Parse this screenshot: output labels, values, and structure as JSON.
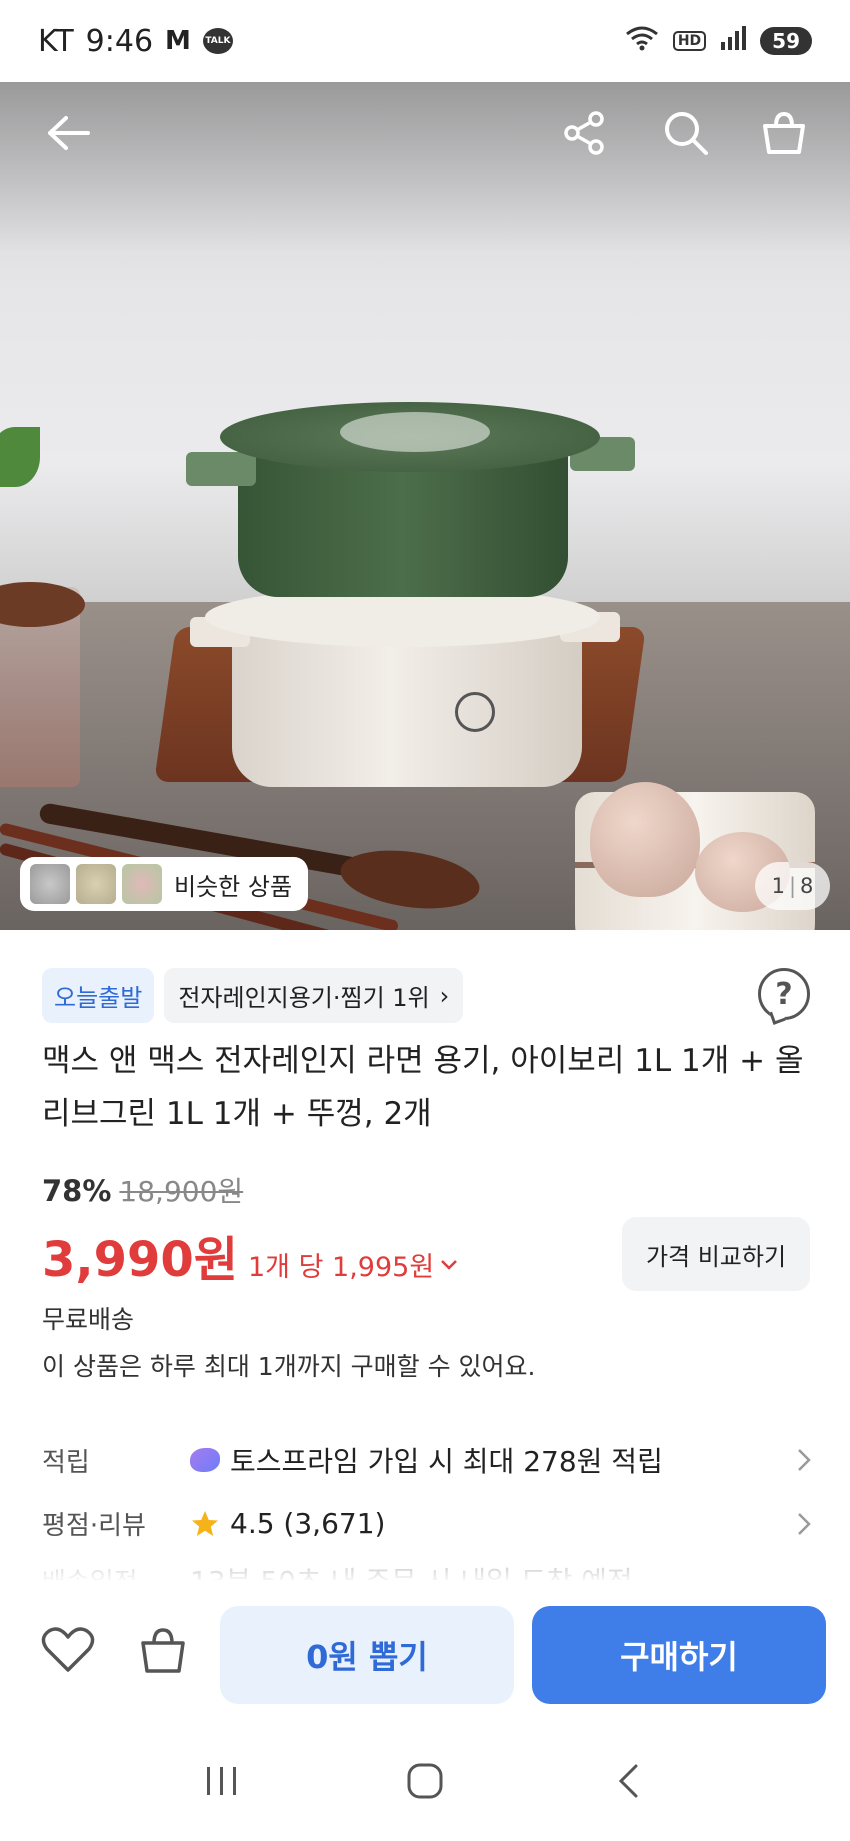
{
  "status_bar": {
    "carrier": "KT",
    "time": "9:46",
    "gmail_glyph": "M",
    "talk_label": "TALK",
    "wifi_label": "6",
    "hd_label": "HD",
    "battery": "59"
  },
  "hero": {
    "similar_label": "비슷한 상품",
    "image_index": "1",
    "image_total": "8"
  },
  "product": {
    "badge_today": "오늘출발",
    "badge_rank": "전자레인지용기·찜기 1위",
    "badge_rank_chevron": "›",
    "help_glyph": "?",
    "title": "맥스 앤 맥스 전자레인지 라면 용기, 아이보리 1L 1개 + 올리브그린 1L 1개 + 뚜껑, 2개",
    "discount_percent": "78%",
    "original_price": "18,900원",
    "price": "3,990원",
    "unit_price": "1개 당 1,995원",
    "compare_label": "가격 비교하기",
    "shipping": "무료배송",
    "purchase_limit": "이 상품은 하루 최대 1개까지 구매할 수 있어요."
  },
  "details": {
    "reward_label": "적립",
    "reward_value": "토스프라임 가입 시 최대 278원 적립",
    "rating_label": "평점·리뷰",
    "rating_value": "4.5 (3,671)",
    "delivery_label": "배송일정",
    "delivery_value": "13분 50초 내 주문 시 내일 도착 예정"
  },
  "bottom_bar": {
    "draw_label": "0원 뽑기",
    "buy_label": "구매하기"
  },
  "colors": {
    "accent_blue": "#3f7ee8",
    "price_red": "#e03c3c",
    "badge_blue": "#2f6ad6"
  }
}
